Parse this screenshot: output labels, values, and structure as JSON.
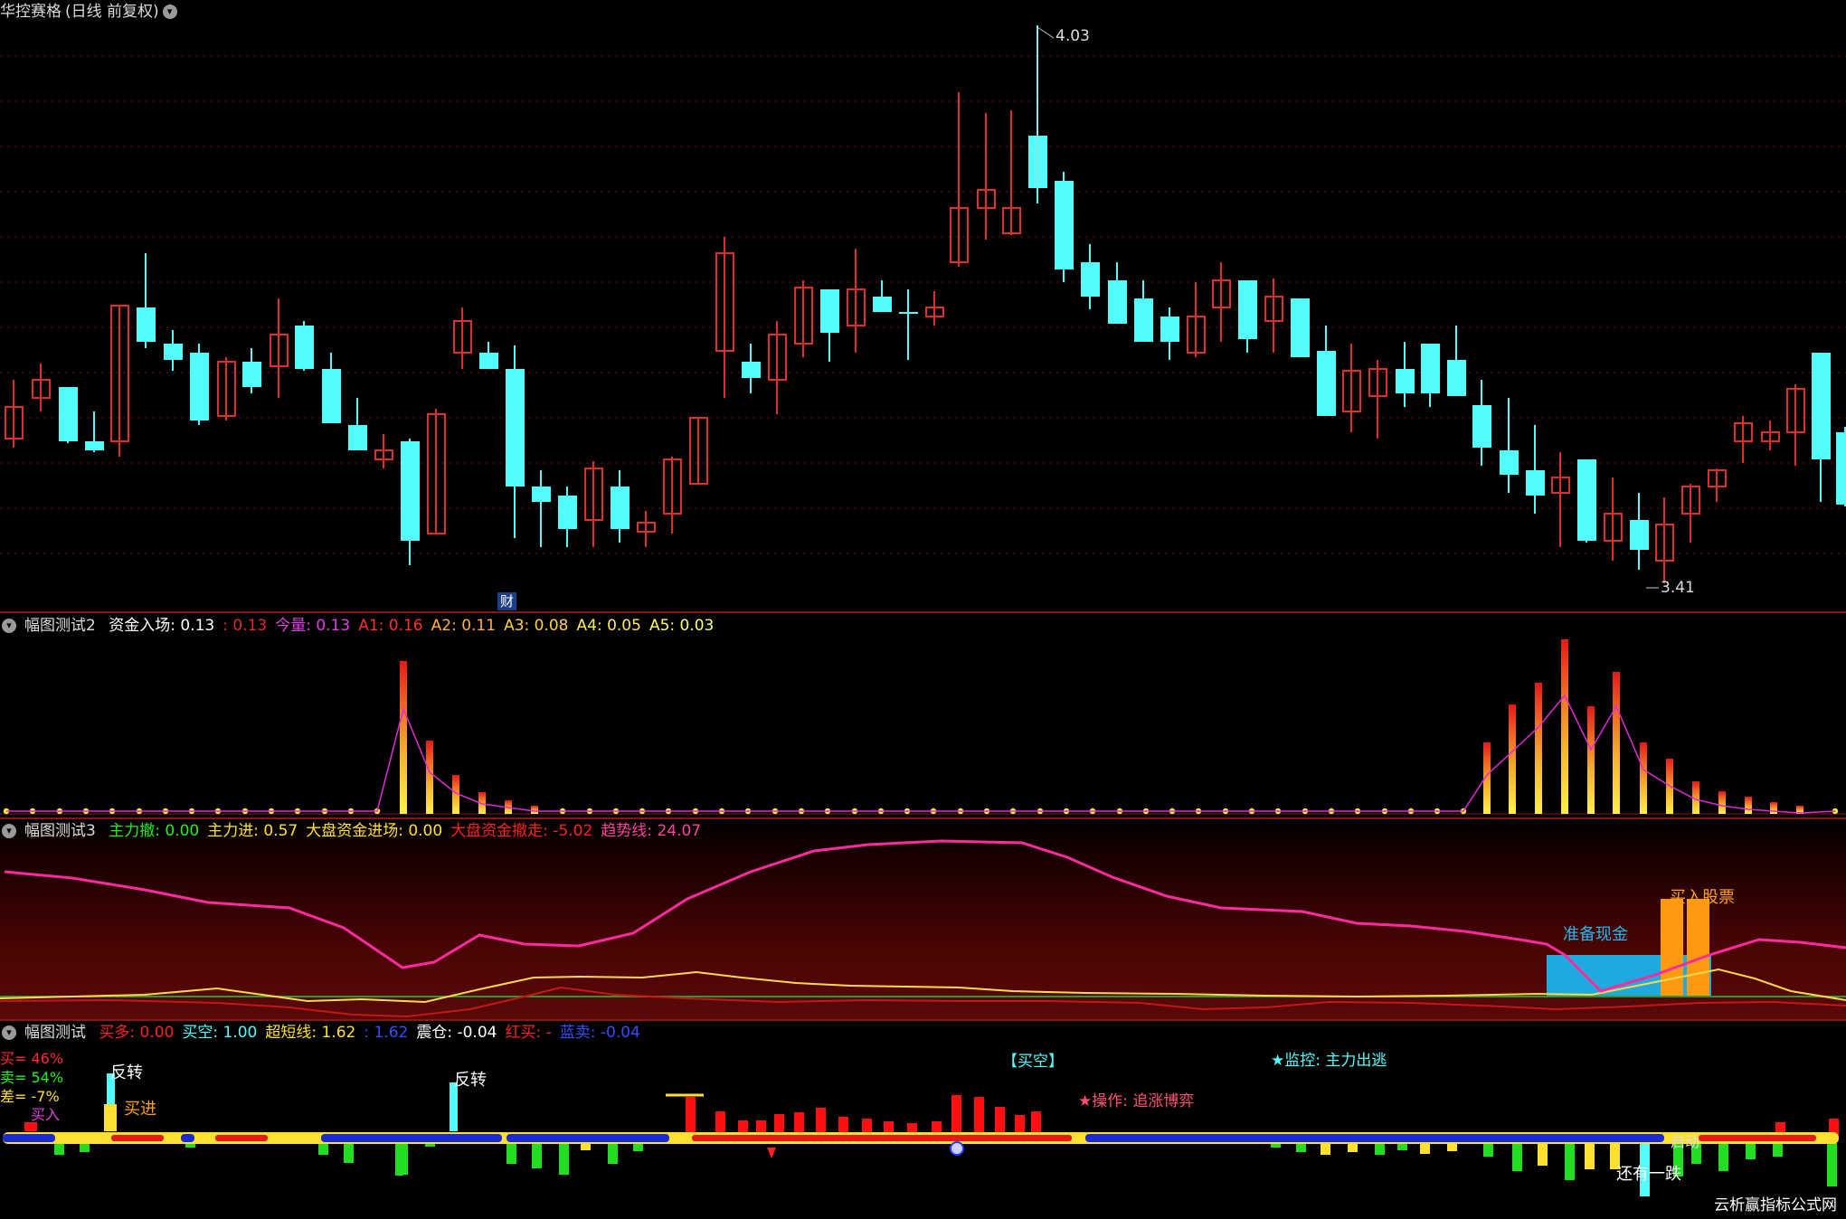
{
  "colors": {
    "up": "#e0302e",
    "down": "#54fcfc",
    "grid": "#5a1010",
    "frame": "#8a1515",
    "magenta": "#ff2aa0",
    "yellow": "#ffd84a",
    "dark_red": "#c21818",
    "orange": "#ff9a10",
    "blue_bar": "#1faadf",
    "lime": "#7be83a",
    "green": "#22dd22"
  },
  "main_panel": {
    "title": "华控赛格",
    "period": "(日线 前复权)",
    "toggle_icon": "chevron-down-icon",
    "high_label": "4.03",
    "low_label": "3.41",
    "finance_marker": "财"
  },
  "panel2": {
    "name": "幅图测试2",
    "items": [
      {
        "label": "资金入场:",
        "value": "0.13",
        "color": "#ffffff"
      },
      {
        "label": ":",
        "value": "0.13",
        "color": "#e02a2a"
      },
      {
        "label": "今量:",
        "value": "0.13",
        "color": "#e040e0"
      },
      {
        "label": "A1:",
        "value": "0.16",
        "color": "#ff3030"
      },
      {
        "label": "A2:",
        "value": "0.11",
        "color": "#ffb040"
      },
      {
        "label": "A3:",
        "value": "0.08",
        "color": "#ffd040"
      },
      {
        "label": "A4:",
        "value": "0.05",
        "color": "#ffe860"
      },
      {
        "label": "A5:",
        "value": "0.03",
        "color": "#ffff70"
      }
    ]
  },
  "panel3": {
    "name": "幅图测试3",
    "items": [
      {
        "label": "主力撤:",
        "value": "0.00",
        "color": "#22ee22"
      },
      {
        "label": "主力进:",
        "value": "0.57",
        "color": "#ffe030"
      },
      {
        "label": "大盘资金进场:",
        "value": "0.00",
        "color": "#ffe030"
      },
      {
        "label": "大盘资金撤走:",
        "value": "-5.02",
        "color": "#ff2020"
      },
      {
        "label": "趋势线:",
        "value": "24.07",
        "color": "#ff40a0"
      }
    ],
    "label_prepare_cash": "准备现金",
    "label_buy_stock": "买入股票"
  },
  "panel4": {
    "name": "幅图测试",
    "items": [
      {
        "label": "买多:",
        "value": "0.00",
        "color": "#ff2020"
      },
      {
        "label": "买空:",
        "value": "1.00",
        "color": "#54fcfc"
      },
      {
        "label": "超短线:",
        "value": "1.62",
        "color": "#ffe030"
      },
      {
        "label": ":",
        "value": "1.62",
        "color": "#3050ff"
      },
      {
        "label": "震仓:",
        "value": "-0.04",
        "color": "#ffffff"
      },
      {
        "label": "红买:",
        "value": "-",
        "color": "#ff2020"
      },
      {
        "label": "蓝卖:",
        "value": "-0.04",
        "color": "#3050ff"
      }
    ],
    "stat_buy": "买= 46%",
    "stat_sell": "卖= 54%",
    "stat_diff": "差= -7%",
    "label_buy_in": "买入",
    "label_reverse1": "反转",
    "label_buy_enter": "买进",
    "label_reverse2": "反转",
    "label_kong": "【买空】",
    "label_monitor": "★监控: 主力出逃",
    "label_operate": "★操作: 追涨博弈",
    "label_still_drop": "还有一跌",
    "label_start": "启动",
    "watermark": "云析赢指标公式网"
  }
}
